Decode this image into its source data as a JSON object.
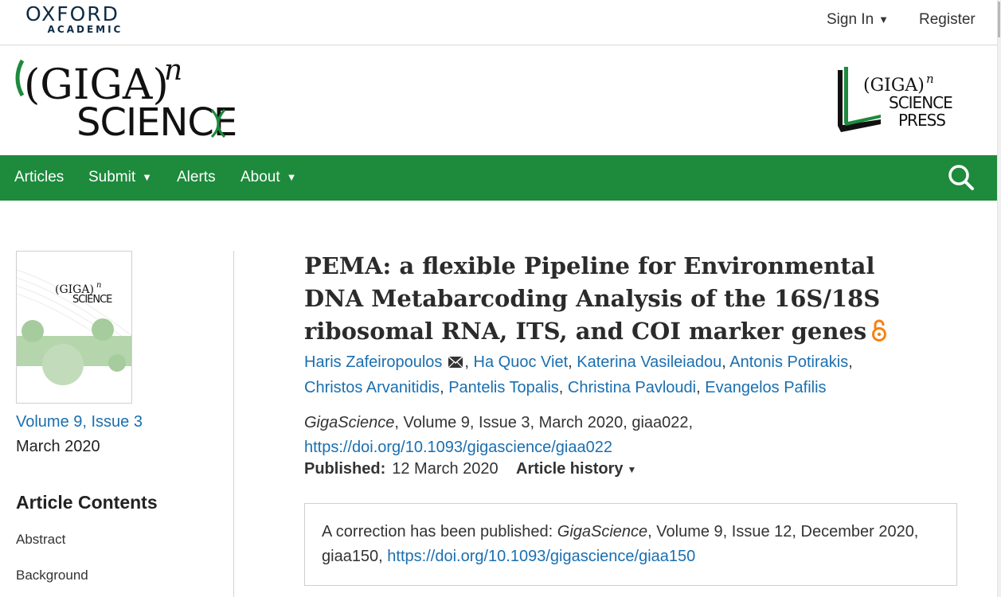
{
  "topbar": {
    "publisher_main": "OXFORD",
    "publisher_sub": "ACADEMIC",
    "signin_label": "Sign In",
    "register_label": "Register"
  },
  "journal": {
    "logo_top": "(GIGA)",
    "logo_exp": "n",
    "logo_bottom": "SCIENCE",
    "press_top": "(GIGA)",
    "press_exp": "n",
    "press_mid": "SCIENCE",
    "press_bottom": "PRESS"
  },
  "nav": {
    "items": [
      {
        "label": "Articles"
      },
      {
        "label": "Submit"
      },
      {
        "label": "Alerts"
      },
      {
        "label": "About"
      }
    ]
  },
  "sidebar": {
    "cover_logo_top": "(GIGA)",
    "cover_logo_exp": "n",
    "cover_logo_bottom": "SCIENCE",
    "issue_link": "Volume 9, Issue 3",
    "issue_date": "March 2020",
    "contents_title": "Article Contents",
    "contents_items": [
      "Abstract",
      "Background"
    ]
  },
  "article": {
    "title": "PEMA: a flexible Pipeline for Environmental DNA Metabarcoding Analysis of the 16S/18S ribosomal RNA, ITS, and COI marker genes",
    "authors": [
      "Haris Zafeiropoulos",
      "Ha Quoc Viet",
      "Katerina Vasileiadou",
      "Antonis Potirakis",
      "Christos Arvanitidis",
      "Pantelis Topalis",
      "Christina Pavloudi",
      "Evangelos Pafilis"
    ],
    "citation_journal": "GigaScience",
    "citation_rest": ", Volume 9, Issue 3, March 2020, giaa022,",
    "doi": "https://doi.org/10.1093/gigascience/giaa022",
    "published_label": "Published:",
    "published_date": "12 March 2020",
    "history_label": "Article history",
    "correction_prefix": "A correction has been published: ",
    "correction_journal": "GigaScience",
    "correction_rest": ", Volume 9, Issue 12, December 2020,",
    "correction_id": "giaa150, ",
    "correction_doi": "https://doi.org/10.1093/gigascience/giaa150"
  },
  "colors": {
    "nav_green": "#1d8a3c",
    "link_blue": "#1a6fb0",
    "open_access_orange": "#f68212"
  }
}
